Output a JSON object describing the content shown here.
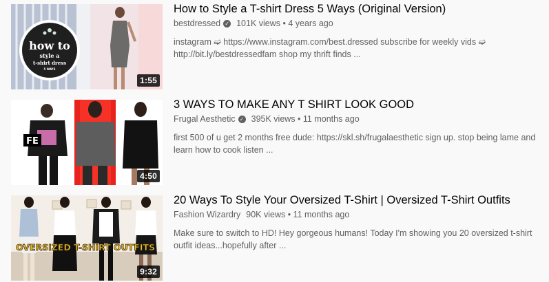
{
  "results": [
    {
      "title": "How to Style a T-shirt Dress 5 Ways (Original Version)",
      "channel": "bestdressed",
      "verified": true,
      "views": "101K views",
      "age": "4 years ago",
      "views_age": "101K views • 4 years ago",
      "description": "instagram ➫ https://www.instagram.com/best.dressed subscribe for weekly vids ➫ http://bit.ly/bestdressedfam shop my thrift finds ...",
      "duration": "1:55",
      "thumb_logo": {
        "line1": "how to",
        "line2": "style a",
        "line3": "t-shirt dress",
        "line4": "5 WAYS"
      }
    },
    {
      "title": "3 WAYS TO MAKE ANY T SHIRT LOOK GOOD",
      "channel": "Frugal Aesthetic",
      "verified": true,
      "views_age": "395K views • 11 months ago",
      "description": "first 500 of u get 2 months free dude: https://skl.sh/frugalaesthetic sign up. stop being lame and learn how to cook listen ...",
      "duration": "4:50",
      "thumb_logo": "FE"
    },
    {
      "title": "20 Ways To Style Your Oversized T-Shirt | Oversized T-Shirt Outfits",
      "channel": "Fashion Wizardry",
      "verified": false,
      "views_age": "90K views • 11 months ago",
      "description": "Make sure to switch to HD! Hey gorgeous humans! Today I'm showing you 20 oversized t-shirt outfit ideas...hopefully after ...",
      "duration": "9:32",
      "thumb_text": "OVERSIZED T-SHIRT OUTFITS"
    }
  ],
  "colors": {
    "background": "#f9f9f9",
    "title": "#030303",
    "secondary": "#606060"
  }
}
